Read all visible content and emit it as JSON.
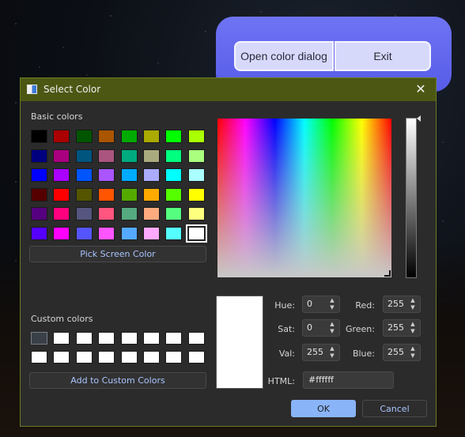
{
  "main_window": {
    "open_label": "Open color dialog",
    "exit_label": "Exit",
    "accent": "#5b60ea"
  },
  "dialog": {
    "title": "Select Color",
    "basic_colors_label": "Basic colors",
    "basic_colors": [
      [
        "#000000",
        "#aa0000",
        "#005500",
        "#aa5500",
        "#00aa00",
        "#aaaa00",
        "#00ff00",
        "#aaff00"
      ],
      [
        "#00007f",
        "#aa007f",
        "#00557f",
        "#aa557f",
        "#00aa7f",
        "#aaaa7f",
        "#00ff7f",
        "#aaff7f"
      ],
      [
        "#0000ff",
        "#aa00ff",
        "#0055ff",
        "#aa55ff",
        "#00aaff",
        "#aaaaff",
        "#00ffff",
        "#aaffff"
      ],
      [
        "#550000",
        "#ff0000",
        "#555500",
        "#ff5500",
        "#55aa00",
        "#ffaa00",
        "#55ff00",
        "#ffff00"
      ],
      [
        "#55007f",
        "#ff007f",
        "#55557f",
        "#ff557f",
        "#55aa7f",
        "#ffaa7f",
        "#55ff7f",
        "#ffff7f"
      ],
      [
        "#5500ff",
        "#ff00ff",
        "#5555ff",
        "#ff55ff",
        "#55aaff",
        "#ffaaff",
        "#55ffff",
        "#ffffff"
      ]
    ],
    "selected_basic": "#ffffff",
    "pick_screen_label": "Pick Screen Color",
    "custom_colors_label": "Custom colors",
    "custom_colors": [
      [
        "#3a4048",
        "#ffffff",
        "#ffffff",
        "#ffffff",
        "#ffffff",
        "#ffffff",
        "#ffffff",
        "#ffffff"
      ],
      [
        "#ffffff",
        "#ffffff",
        "#ffffff",
        "#ffffff",
        "#ffffff",
        "#ffffff",
        "#ffffff",
        "#ffffff"
      ]
    ],
    "add_custom_label": "Add to Custom Colors",
    "fields": {
      "hue_label": "Hue:",
      "hue": "0",
      "sat_label": "Sat:",
      "sat": "0",
      "val_label": "Val:",
      "val": "255",
      "red_label": "Red:",
      "red": "255",
      "green_label": "Green:",
      "green": "255",
      "blue_label": "Blue:",
      "blue": "255",
      "html_label": "HTML:",
      "html": "#ffffff"
    },
    "current_color": "#ffffff",
    "ok_label": "OK",
    "cancel_label": "Cancel"
  }
}
